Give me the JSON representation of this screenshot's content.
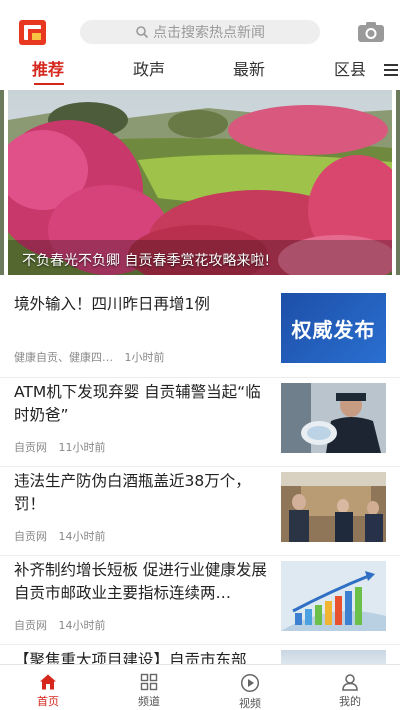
{
  "header": {
    "search_placeholder": "点击搜索热点新闻",
    "brand_color": "#e8381f"
  },
  "tabs": [
    {
      "label": "推荐",
      "active": true
    },
    {
      "label": "政声",
      "active": false
    },
    {
      "label": "最新",
      "active": false
    },
    {
      "label": "区县",
      "active": false
    }
  ],
  "banner": {
    "caption": "不负春光不负卿 自贡春季赏花攻略来啦!"
  },
  "news": [
    {
      "title": "境外输入！四川昨日再增1例",
      "source": "健康自贡、健康四…",
      "time": "1小时前",
      "thumb_text": "权威发布"
    },
    {
      "title": "ATM机下发现弃婴  自贡辅警当起“临时奶爸”",
      "source": "自贡网",
      "time": "11小时前"
    },
    {
      "title": "违法生产防伪白酒瓶盖近38万个，罚！",
      "source": "自贡网",
      "time": "14小时前"
    },
    {
      "title": "补齐制约增长短板  促进行业健康发展  自贡市邮政业主要指标连续两…",
      "source": "自贡网",
      "time": "14小时前"
    }
  ],
  "partial_item": {
    "title": "【聚焦重大项目建设】自贡市东部"
  },
  "bottom_nav": [
    {
      "label": "首页",
      "active": true
    },
    {
      "label": "频道",
      "active": false
    },
    {
      "label": "视频",
      "active": false
    },
    {
      "label": "我的",
      "active": false
    }
  ],
  "colors": {
    "accent": "#d6271d",
    "inactive_text": "#555555"
  }
}
